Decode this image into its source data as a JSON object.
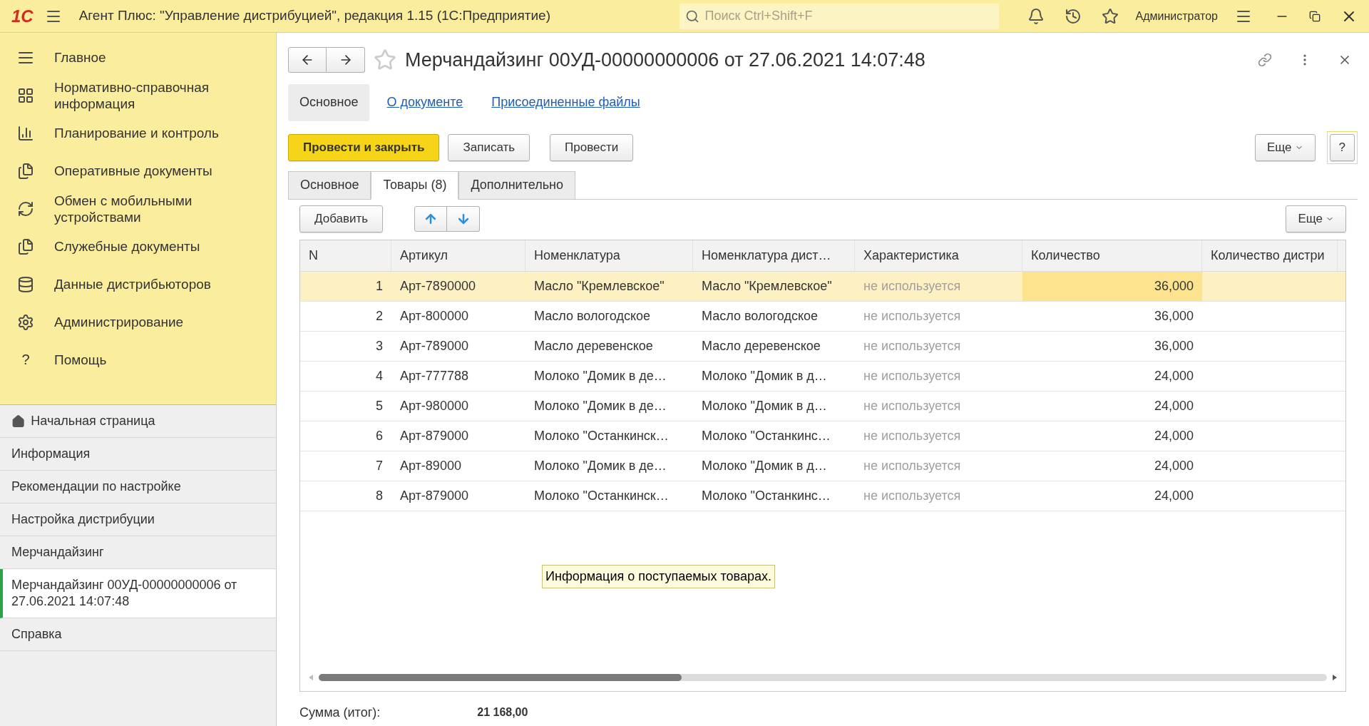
{
  "window": {
    "title": "Агент Плюс: \"Управление дистрибуцией\", редакция 1.15  (1С:Предприятие)",
    "logo": "1С",
    "search": {
      "placeholder": "Поиск Ctrl+Shift+F"
    },
    "user": "Администратор"
  },
  "sections": [
    {
      "label": "Главное"
    },
    {
      "label": "Нормативно-справочная информация"
    },
    {
      "label": "Планирование и контроль"
    },
    {
      "label": "Оперативные документы"
    },
    {
      "label": "Обмен с мобильными устройствами"
    },
    {
      "label": "Служебные документы"
    },
    {
      "label": "Данные дистрибьюторов"
    },
    {
      "label": "Администрирование"
    },
    {
      "label": "Помощь",
      "icon": "?"
    }
  ],
  "open_pages": [
    {
      "label": "Начальная страница",
      "kind": "home",
      "selected": false
    },
    {
      "label": "Информация",
      "kind": "page",
      "selected": false
    },
    {
      "label": "Рекомендации по настройке",
      "kind": "page",
      "selected": false
    },
    {
      "label": "Настройка дистрибуции",
      "kind": "page",
      "selected": false
    },
    {
      "label": "Мерчандайзинг",
      "kind": "page",
      "selected": false
    },
    {
      "label": "Мерчандайзинг 00УД-00000000006 от 27.06.2021 14:07:48",
      "kind": "page",
      "selected": true
    },
    {
      "label": "Справка",
      "kind": "page",
      "selected": false
    }
  ],
  "form": {
    "title": "Мерчандайзинг 00УД-00000000006 от 27.06.2021 14:07:48",
    "nav_tabs": [
      {
        "label": "Основное",
        "selected": true
      },
      {
        "label": "О документе",
        "selected": false
      },
      {
        "label": "Присоединенные файлы",
        "selected": false
      }
    ],
    "buttons": [
      {
        "label": "Провести и закрыть",
        "kind": "primary"
      },
      {
        "label": "Записать",
        "kind": "normal"
      },
      {
        "label": "Провести",
        "kind": "normal"
      }
    ],
    "more_button": "Еще",
    "help_button": "?",
    "tabs": [
      {
        "label": "Основное",
        "selected": false
      },
      {
        "label": "Товары (8)",
        "selected": true
      },
      {
        "label": "Дополнительно",
        "selected": false
      }
    ],
    "table_toolbar": {
      "add_button": "Добавить",
      "more_button": "Еще"
    },
    "table": {
      "columns": [
        "N",
        "Артикул",
        "Номенклатура",
        "Номенклатура дист…",
        "Характеристика",
        "Количество",
        "Количество дистри"
      ],
      "rows": [
        {
          "n": "1",
          "article": "Арт-7890000",
          "name": "Масло \"Кремлевское\"",
          "name_dist": "Масло \"Кремлевское\"",
          "characteristic": "не используется",
          "quantity": "36,000",
          "selected": true
        },
        {
          "n": "2",
          "article": "Арт-800000",
          "name": "Масло вологодское",
          "name_dist": "Масло вологодское",
          "characteristic": "не используется",
          "quantity": "36,000",
          "selected": false
        },
        {
          "n": "3",
          "article": "Арт-789000",
          "name": "Масло деревенское",
          "name_dist": "Масло деревенское",
          "characteristic": "не используется",
          "quantity": "36,000",
          "selected": false
        },
        {
          "n": "4",
          "article": "Арт-777788",
          "name": "Молоко \"Домик в де…",
          "name_dist": "Молоко \"Домик в д…",
          "characteristic": "не используется",
          "quantity": "24,000",
          "selected": false
        },
        {
          "n": "5",
          "article": "Арт-980000",
          "name": "Молоко \"Домик в де…",
          "name_dist": "Молоко \"Домик в д…",
          "characteristic": "не используется",
          "quantity": "24,000",
          "selected": false
        },
        {
          "n": "6",
          "article": "Арт-879000",
          "name": "Молоко \"Останкинск…",
          "name_dist": "Молоко \"Останкинс…",
          "characteristic": "не используется",
          "quantity": "24,000",
          "selected": false
        },
        {
          "n": "7",
          "article": "Арт-89000",
          "name": "Молоко \"Домик в де…",
          "name_dist": "Молоко \"Домик в д…",
          "characteristic": "не используется",
          "quantity": "24,000",
          "selected": false
        },
        {
          "n": "8",
          "article": "Арт-879000",
          "name": "Молоко \"Останкинск…",
          "name_dist": "Молоко \"Останкинс…",
          "characteristic": "не используется",
          "quantity": "24,000",
          "selected": false
        }
      ]
    },
    "tooltip": "Информация о поступаемых товарах.",
    "total": {
      "label": "Сумма (итог):",
      "value": "21 168,00"
    }
  }
}
